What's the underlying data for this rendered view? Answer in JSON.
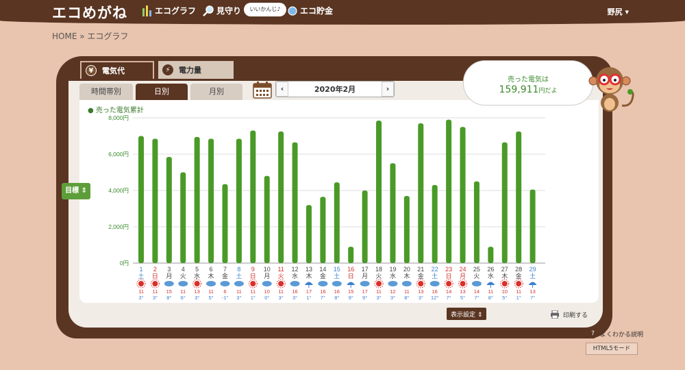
{
  "header": {
    "logo": "エコめがね",
    "nav_graph": "エコグラフ",
    "nav_watch": "見守り",
    "nav_bubble": "いいかんじ♪",
    "nav_savings": "エコ貯金",
    "user": "野尻 ▾"
  },
  "breadcrumb": "HOME » エコグラフ",
  "tabs": {
    "electricity_cost": "電気代",
    "power_amount": "電力量",
    "coin_yen": "¥"
  },
  "subtabs": {
    "hourly": "時間帯別",
    "daily": "日別",
    "monthly": "月別"
  },
  "date": {
    "label": "2020年2月",
    "prev": "‹",
    "next": "›"
  },
  "speech": {
    "line1": "売った電気は",
    "value": "159,911",
    "suffix": "円だよ"
  },
  "goal_button": "目標 ⇕",
  "display_settings": "表示設定 ⇕",
  "print_label": "印刷する",
  "help_label": "よくわかる説明",
  "html5_label": "HTML5モード",
  "colors": {
    "bar": "#4a9a28",
    "header": "#5a3522",
    "background": "#e9c4ae",
    "saturday": "#3b7fd0",
    "sunday": "#d0302a"
  },
  "chart_data": {
    "type": "bar",
    "legend": "売った電気累計",
    "ylim": [
      0,
      8000
    ],
    "yticks": [
      "0円",
      "2,000円",
      "4,000円",
      "6,000円",
      "8,000円"
    ],
    "ytick_values": [
      0,
      2000,
      4000,
      6000,
      8000
    ],
    "categories": [
      "1",
      "2",
      "3",
      "4",
      "5",
      "6",
      "7",
      "8",
      "9",
      "10",
      "11",
      "12",
      "13",
      "14",
      "15",
      "16",
      "17",
      "18",
      "19",
      "20",
      "21",
      "22",
      "23",
      "24",
      "25",
      "26",
      "27",
      "28",
      "29"
    ],
    "weekdays": [
      "土",
      "日",
      "月",
      "火",
      "水",
      "木",
      "金",
      "土",
      "日",
      "月",
      "火",
      "水",
      "木",
      "金",
      "土",
      "日",
      "月",
      "火",
      "水",
      "木",
      "金",
      "土",
      "日",
      "月",
      "火",
      "水",
      "木",
      "金",
      "土"
    ],
    "day_colors": [
      "sat",
      "sun",
      "",
      "",
      "",
      "",
      "",
      "sat",
      "sun",
      "",
      "sun",
      "",
      "",
      "",
      "sat",
      "sun",
      "",
      "",
      "",
      "",
      "",
      "sat",
      "sun",
      "sun",
      "",
      "",
      "",
      "",
      "sat"
    ],
    "weather": [
      "sun",
      "sun",
      "cloud",
      "cloud",
      "sun",
      "cloud",
      "cloud",
      "cloud",
      "sun",
      "cloud",
      "sun",
      "cloud",
      "rain",
      "cloud",
      "cloud",
      "rain",
      "cloud",
      "sun",
      "cloud",
      "cloud",
      "sun",
      "cloud",
      "sun",
      "sun",
      "cloud",
      "rain",
      "sun",
      "sun",
      "rain"
    ],
    "high": [
      "11",
      "11",
      "15",
      "11",
      "13",
      "11",
      "6",
      "11",
      "11",
      "10",
      "11",
      "16",
      "17",
      "16",
      "16",
      "15",
      "17",
      "11",
      "12",
      "11",
      "13",
      "16",
      "14",
      "13",
      "14",
      "11",
      "10",
      "11",
      "13"
    ],
    "low": [
      "3",
      "3",
      "8",
      "6",
      "3",
      "5",
      "-1",
      "3",
      "1",
      "0",
      "3",
      "3",
      "1",
      "7",
      "8",
      "9",
      "9",
      "3",
      "3",
      "8",
      "3",
      "12",
      "7",
      "5",
      "7",
      "8",
      "5",
      "1",
      "7"
    ],
    "values": [
      7000,
      6850,
      5850,
      5000,
      6950,
      6850,
      4350,
      6850,
      7300,
      4800,
      7250,
      6650,
      3200,
      3650,
      4450,
      900,
      4000,
      7850,
      5500,
      3700,
      7700,
      4300,
      7900,
      7500,
      4500,
      900,
      6650,
      7250,
      4050
    ]
  }
}
